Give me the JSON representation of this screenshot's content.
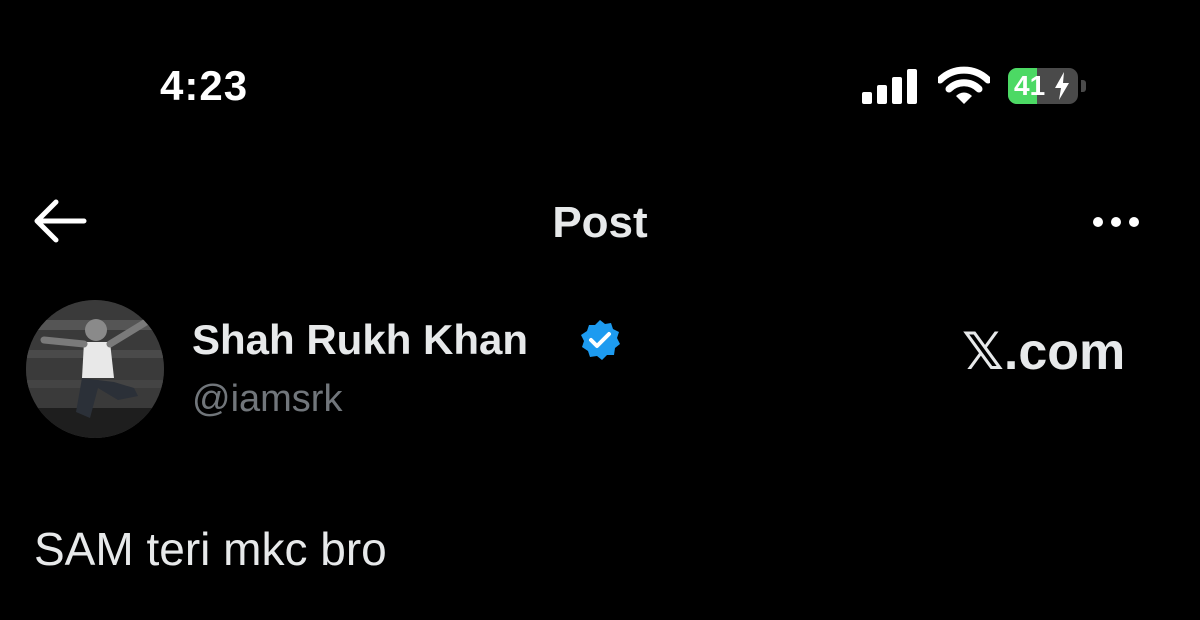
{
  "status_bar": {
    "time": "4:23",
    "battery_level": "41",
    "battery_fraction": 0.41,
    "battery_charging": true,
    "signal_icon": "cellular-signal-icon",
    "wifi_icon": "wifi-icon",
    "colors": {
      "battery_green": "#4cd964"
    }
  },
  "nav": {
    "title": "Post",
    "back_icon": "back-arrow-icon",
    "more_icon": "more-options-icon"
  },
  "post": {
    "author_name": "Shah Rukh Khan",
    "author_handle": "@iamsrk",
    "verified": true,
    "verified_icon": "verified-badge-icon",
    "watermark": "𝕏.com",
    "text": "SAM teri mkc bro",
    "colors": {
      "verified_blue": "#1d9bf0",
      "handle_gray": "#71767b",
      "text": "#e7e9ea"
    }
  }
}
